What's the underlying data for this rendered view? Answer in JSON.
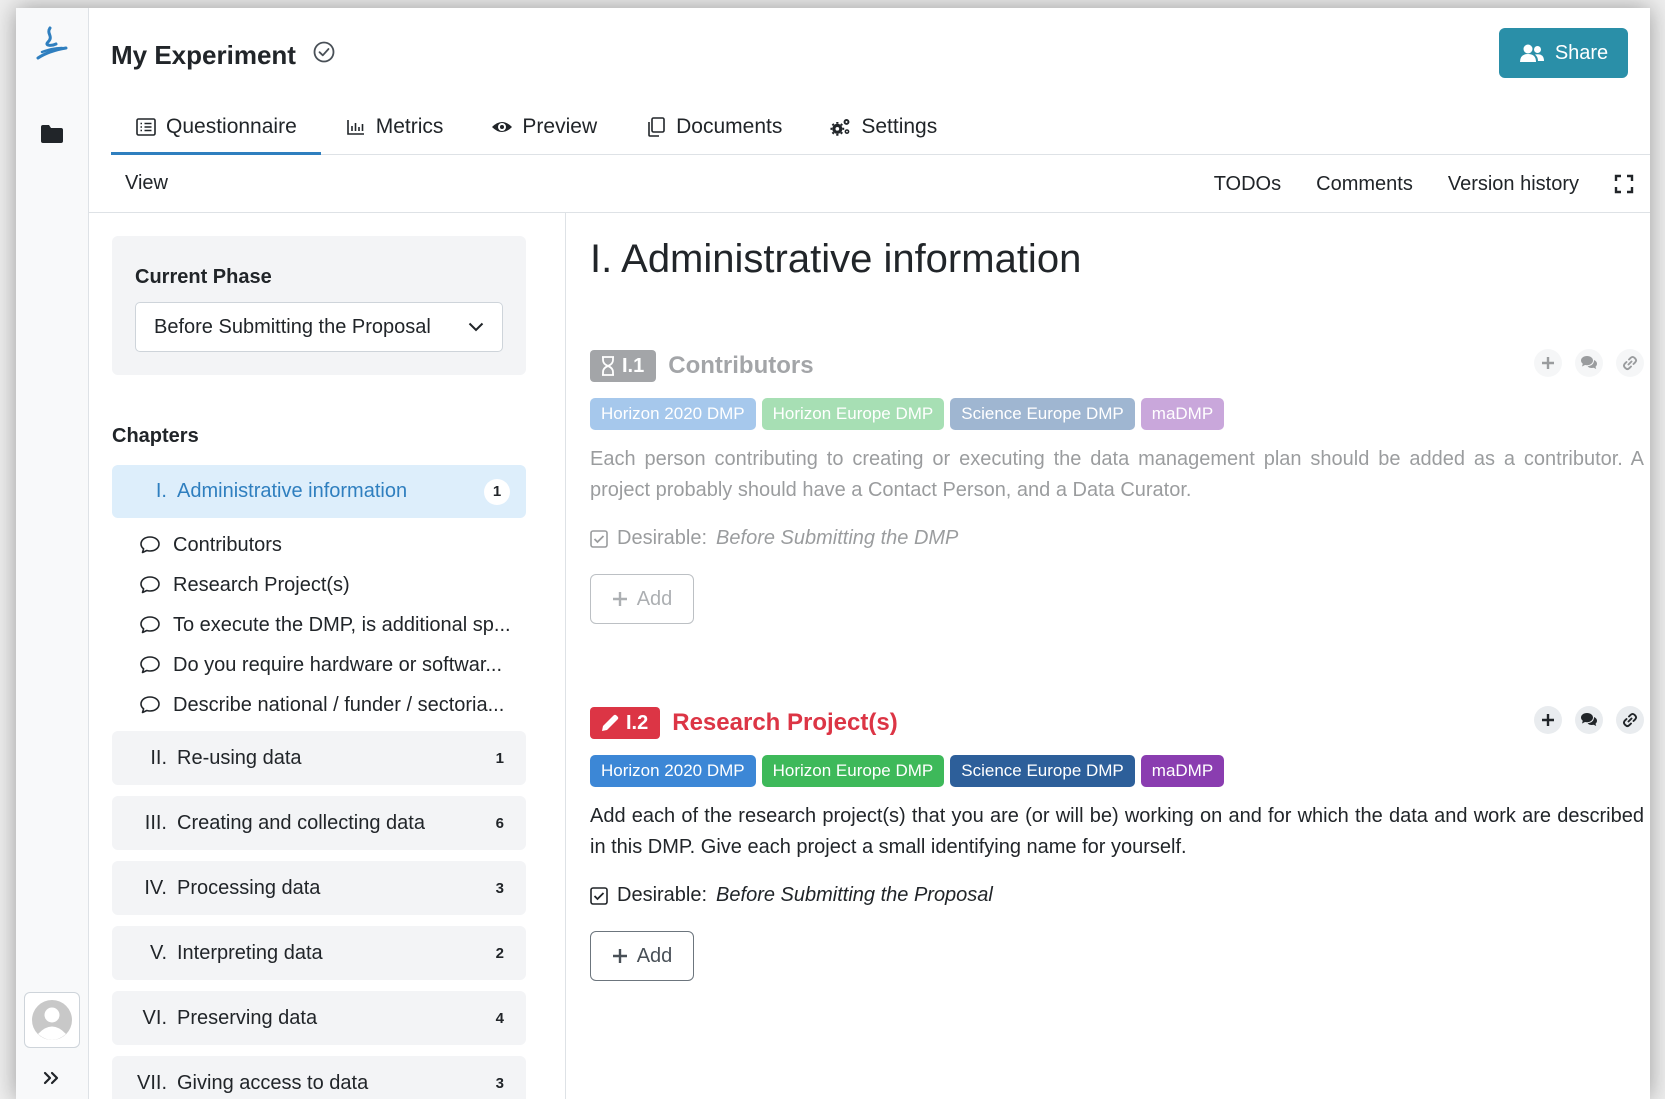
{
  "app": {
    "title": "My Experiment",
    "share_label": "Share"
  },
  "tabs": [
    {
      "label": "Questionnaire",
      "icon": "list-icon",
      "active": true
    },
    {
      "label": "Metrics",
      "icon": "bar-chart-icon",
      "active": false
    },
    {
      "label": "Preview",
      "icon": "eye-icon",
      "active": false
    },
    {
      "label": "Documents",
      "icon": "copy-icon",
      "active": false
    },
    {
      "label": "Settings",
      "icon": "gears-icon",
      "active": false
    }
  ],
  "toolbar": {
    "view_label": "View",
    "todos_label": "TODOs",
    "comments_label": "Comments",
    "version_history_label": "Version history"
  },
  "sidebar": {
    "phase_label": "Current Phase",
    "phase_value": "Before Submitting the Proposal",
    "chapters_label": "Chapters",
    "chapters": [
      {
        "num": "I.",
        "name": "Administrative information",
        "count": "1",
        "active": true
      },
      {
        "num": "II.",
        "name": "Re-using data",
        "count": "1"
      },
      {
        "num": "III.",
        "name": "Creating and collecting data",
        "count": "6"
      },
      {
        "num": "IV.",
        "name": "Processing data",
        "count": "3"
      },
      {
        "num": "V.",
        "name": "Interpreting data",
        "count": "2"
      },
      {
        "num": "VI.",
        "name": "Preserving data",
        "count": "4"
      },
      {
        "num": "VII.",
        "name": "Giving access to data",
        "count": "3"
      }
    ],
    "questions": [
      "Contributors",
      "Research Project(s)",
      "To execute the DMP, is additional sp...",
      "Do you require hardware or softwar...",
      "Describe national / funder / sectoria..."
    ]
  },
  "main": {
    "heading": "I. Administrative information",
    "questions": [
      {
        "badge": "I.1",
        "title": "Contributors",
        "badge_color": "#343a40",
        "title_color": "#343a40",
        "tags": [
          "Horizon 2020 DMP",
          "Horizon Europe DMP",
          "Science Europe DMP",
          "maDMP"
        ],
        "text": "Each person contributing to creating or executing the data management plan should be added as a contributor. A project probably should have a Contact Person, and a Data Curator.",
        "desirable_label": "Desirable:",
        "desirable_phase": "Before Submitting the DMP",
        "add_label": "Add"
      },
      {
        "badge": "I.2",
        "title": "Research Project(s)",
        "badge_color": "#dc3545",
        "title_color": "#dc3545",
        "tags": [
          "Horizon 2020 DMP",
          "Horizon Europe DMP",
          "Science Europe DMP",
          "maDMP"
        ],
        "text": "Add each of the research project(s) that you are (or will be) working on and for which the data and work are described in this DMP. Give each project a small identifying name for yourself.",
        "desirable_label": "Desirable:",
        "desirable_phase": "Before Submitting the Proposal",
        "add_label": "Add"
      }
    ]
  },
  "tag_colors": {
    "Horizon 2020 DMP": "#3c87d6",
    "Horizon Europe DMP": "#3eb95a",
    "Science Europe DMP": "#2d5f9a",
    "maDMP": "#8a3db0"
  }
}
